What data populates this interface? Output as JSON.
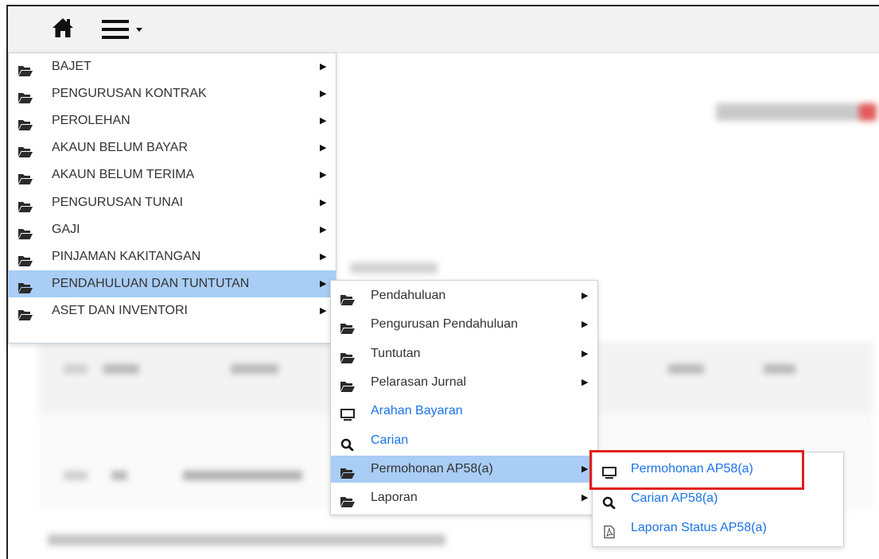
{
  "toolbar": {
    "home_icon": "home-icon",
    "menu_icon": "hamburger-menu-icon"
  },
  "colors": {
    "active_bg": "#a9cdf5",
    "link": "#1a73e8",
    "highlight": "#e11d1d"
  },
  "main_menu": {
    "items": [
      {
        "label": "BAJET"
      },
      {
        "label": "PENGURUSAN KONTRAK"
      },
      {
        "label": "PEROLEHAN"
      },
      {
        "label": "AKAUN BELUM BAYAR"
      },
      {
        "label": "AKAUN BELUM TERIMA"
      },
      {
        "label": "PENGURUSAN TUNAI"
      },
      {
        "label": "GAJI"
      },
      {
        "label": "PINJAMAN KAKITANGAN"
      },
      {
        "label": "PENDAHULUAN DAN TUNTUTAN",
        "active": true
      },
      {
        "label": "ASET DAN INVENTORI"
      }
    ]
  },
  "sub_menu": {
    "items": [
      {
        "label": "Pendahuluan",
        "icon": "folder-open-icon"
      },
      {
        "label": "Pengurusan Pendahuluan",
        "icon": "folder-open-icon"
      },
      {
        "label": "Tuntutan",
        "icon": "folder-open-icon"
      },
      {
        "label": "Pelarasan Jurnal",
        "icon": "folder-open-icon"
      },
      {
        "label": "Arahan Bayaran",
        "icon": "monitor-icon",
        "link": true
      },
      {
        "label": "Carian",
        "icon": "search-icon",
        "link": true
      },
      {
        "label": "Permohonan AP58(a)",
        "icon": "folder-open-icon",
        "active": true
      },
      {
        "label": "Laporan",
        "icon": "folder-open-icon"
      }
    ]
  },
  "sub_sub_menu": {
    "items": [
      {
        "label": "Permohonan AP58(a)",
        "icon": "monitor-icon"
      },
      {
        "label": "Carian AP58(a)",
        "icon": "search-icon"
      },
      {
        "label": "Laporan Status AP58(a)",
        "icon": "pdf-file-icon"
      }
    ]
  }
}
